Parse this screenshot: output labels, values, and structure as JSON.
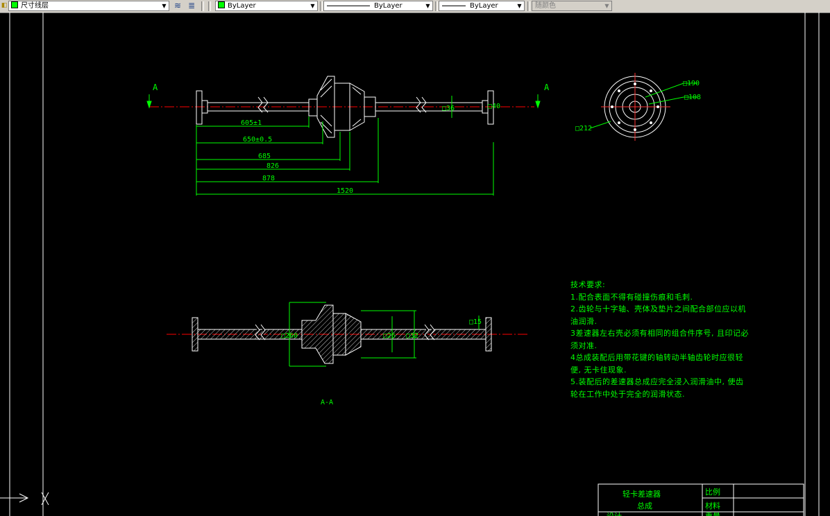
{
  "toolbar": {
    "layer_name": "尺寸线层",
    "color_value": "ByLayer",
    "linetype_value": "ByLayer",
    "lineweight_value": "ByLayer",
    "plotstyle_value": "随颜色"
  },
  "drawing": {
    "section_mark_left": "A",
    "section_mark_right": "A",
    "dim_605": "605±1",
    "dim_650": "650±0.5",
    "dim_685": "685",
    "dim_826": "826",
    "dim_878": "878",
    "dim_1520": "1520",
    "dim_d36": "□36",
    "dim_d40": "□40",
    "dim_d190": "□190",
    "dim_d108": "□108",
    "dim_d212": "□212",
    "dim_d260": "□260",
    "dim_d26": "□26",
    "dim_d32": "□32",
    "dim_d15": "□15",
    "section_label": "A-A"
  },
  "tech_requirements": {
    "title": "技术要求:",
    "lines": [
      "1.配合表面不得有碰撞伤痕和毛刺.",
      "2.齿轮与十字轴、壳体及垫片之间配合部位应以机",
      "油润滑.",
      "3差速器左右壳必须有相同的组合件序号, 且印记必",
      "须对准.",
      "4总成装配后用带花键的轴转动半轴齿轮时应很轻",
      "便, 无卡住现象.",
      "5.装配后的差速器总成应完全浸入润滑油中, 使齿",
      "轮在工作中处于完全的润滑状态."
    ]
  },
  "title_block": {
    "name_line1": "轻卡差速器",
    "name_line2": "总成",
    "scale_label": "比例",
    "material_label": "材料",
    "design_label": "设计",
    "weight_label": "重量"
  },
  "colors": {
    "background": "#000000",
    "dimension": "#00ff00",
    "geometry": "#ffffff",
    "centerline": "#ff0000"
  }
}
